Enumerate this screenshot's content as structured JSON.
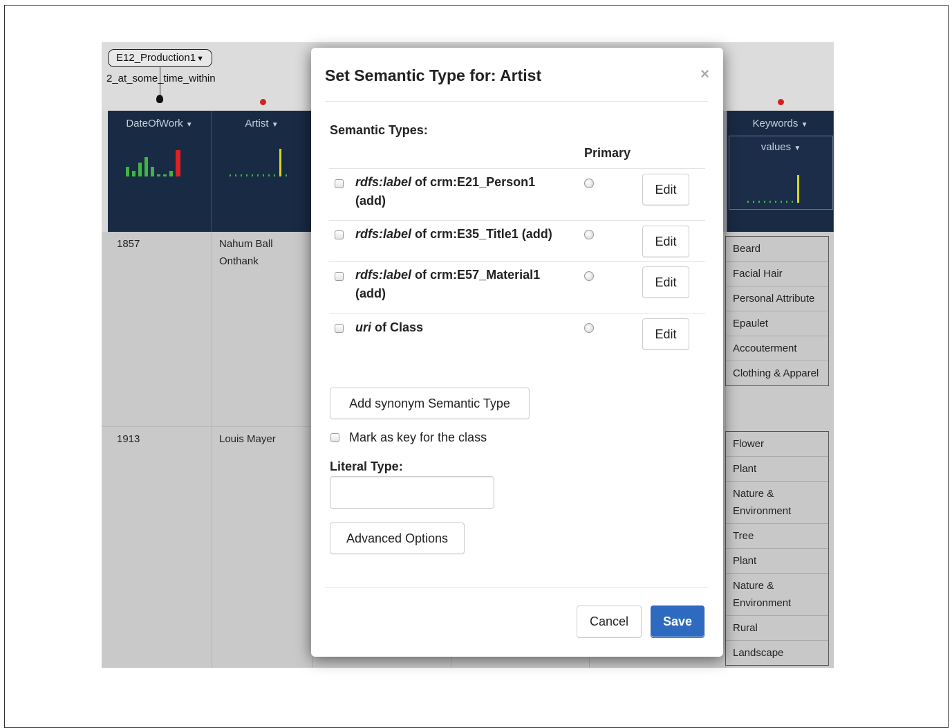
{
  "background_app": {
    "node_label": "E12_Production1",
    "edge_label": "2_at_some_time_within",
    "columns": [
      {
        "name": "DateOfWork"
      },
      {
        "name": "Artist"
      },
      {
        "name": "Keywords",
        "sub_header": "values"
      }
    ],
    "rows": [
      {
        "date": "1857",
        "artist": "Nahum Ball Onthank"
      },
      {
        "date": "1913",
        "artist": "Louis Mayer"
      }
    ],
    "keywords_group_1": [
      "Beard",
      "Facial Hair",
      "Personal Attribute",
      "Epaulet",
      "Accouterment",
      "Clothing & Apparel"
    ],
    "keywords_group_2": [
      "Flower",
      "Plant",
      "Nature & Environment",
      "Tree",
      "Plant",
      "Nature & Environment",
      "Rural",
      "Landscape"
    ],
    "colors": {
      "header_bg": "#192a44",
      "bar_green": "#3fb63f",
      "bar_red": "#e02020",
      "bar_yellow": "#d8d820",
      "dot_red": "#d62020"
    }
  },
  "modal": {
    "title": "Set Semantic Type for: Artist",
    "close_glyph": "×",
    "semantic_types_label": "Semantic Types:",
    "primary_header": "Primary",
    "types": [
      {
        "property": "rdfs:label",
        "rest_line1": " of crm:E21_Person1",
        "rest_line2": "(add)",
        "edit_label": "Edit"
      },
      {
        "property": "rdfs:label",
        "rest_line1": " of crm:E35_Title1 (add)",
        "rest_line2": "",
        "edit_label": "Edit"
      },
      {
        "property": "rdfs:label",
        "rest_line1": " of crm:E57_Material1",
        "rest_line2": "(add)",
        "edit_label": "Edit"
      },
      {
        "property": "uri",
        "rest_line1": " of Class",
        "rest_line2": "",
        "edit_label": "Edit"
      }
    ],
    "add_synonym_label": "Add synonym Semantic Type",
    "mark_key_label": "Mark as key for the class",
    "literal_type_label": "Literal Type:",
    "literal_type_value": "",
    "advanced_options_label": "Advanced Options",
    "cancel_label": "Cancel",
    "save_label": "Save",
    "save_color": "#2e6bc0"
  }
}
